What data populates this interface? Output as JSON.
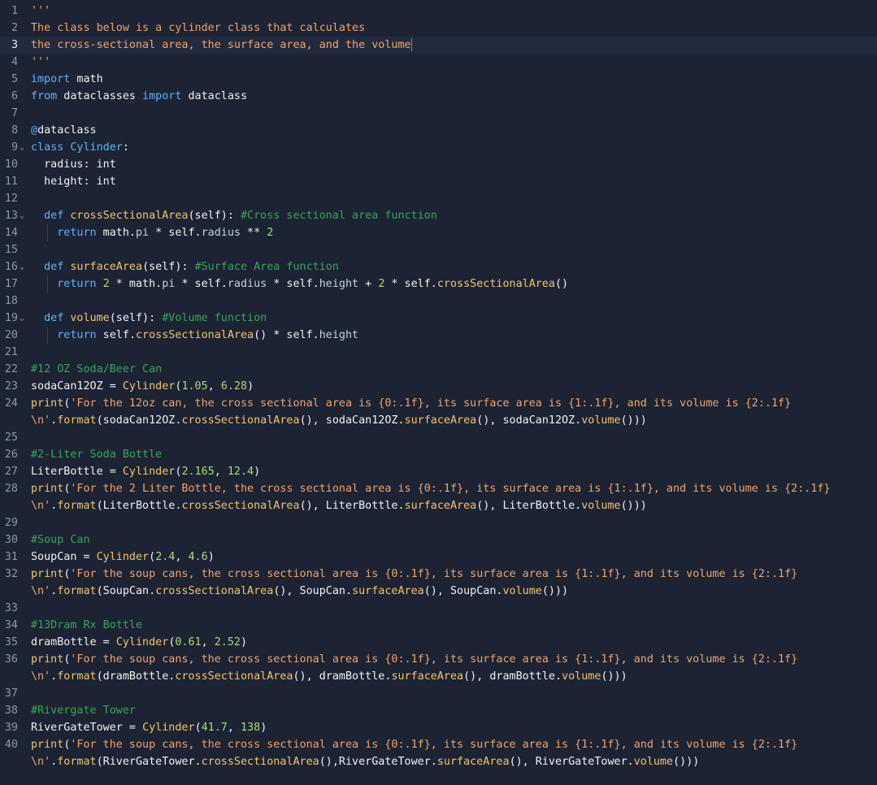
{
  "editor": {
    "lines": [
      {
        "n": "1",
        "tokens": [
          {
            "t": "'''",
            "c": "str"
          }
        ]
      },
      {
        "n": "2",
        "tokens": [
          {
            "t": "The class below is a cylinder class that calculates",
            "c": "str"
          }
        ]
      },
      {
        "n": "3",
        "current": true,
        "tokens": [
          {
            "t": "the cross-sectional area, the surface area, and the volume",
            "c": "str"
          }
        ]
      },
      {
        "n": "4",
        "tokens": [
          {
            "t": "'''",
            "c": "str"
          }
        ]
      },
      {
        "n": "5",
        "tokens": [
          {
            "t": "import",
            "c": "kw"
          },
          {
            "t": " math",
            "c": "plain"
          }
        ]
      },
      {
        "n": "6",
        "tokens": [
          {
            "t": "from",
            "c": "kw"
          },
          {
            "t": " dataclasses ",
            "c": "plain"
          },
          {
            "t": "import",
            "c": "kw"
          },
          {
            "t": " dataclass",
            "c": "plain"
          }
        ]
      },
      {
        "n": "7",
        "tokens": []
      },
      {
        "n": "8",
        "tokens": [
          {
            "t": "@",
            "c": "kw"
          },
          {
            "t": "dataclass",
            "c": "plain"
          }
        ]
      },
      {
        "n": "9",
        "fold": true,
        "tokens": [
          {
            "t": "class",
            "c": "kw"
          },
          {
            "t": " Cylinder",
            "c": "cls"
          },
          {
            "t": ":",
            "c": "plain"
          }
        ]
      },
      {
        "n": "10",
        "tokens": [
          {
            "t": "  radius: int",
            "c": "plain"
          }
        ]
      },
      {
        "n": "11",
        "tokens": [
          {
            "t": "  height: int",
            "c": "plain"
          }
        ]
      },
      {
        "n": "12",
        "tokens": []
      },
      {
        "n": "13",
        "fold": true,
        "tokens": [
          {
            "t": "  ",
            "c": "plain"
          },
          {
            "t": "def",
            "c": "kw"
          },
          {
            "t": " crossSectionalArea",
            "c": "fn"
          },
          {
            "t": "(self): ",
            "c": "plain"
          },
          {
            "t": "#Cross sectional area function",
            "c": "com"
          }
        ]
      },
      {
        "n": "14",
        "tokens": [
          {
            "t": "    ",
            "c": "plain"
          },
          {
            "t": "return",
            "c": "kw"
          },
          {
            "t": " math.",
            "c": "plain"
          },
          {
            "t": "pi",
            "c": "attr"
          },
          {
            "t": " * self.",
            "c": "plain"
          },
          {
            "t": "radius",
            "c": "attr"
          },
          {
            "t": " ** ",
            "c": "plain"
          },
          {
            "t": "2",
            "c": "num"
          }
        ]
      },
      {
        "n": "15",
        "tokens": []
      },
      {
        "n": "16",
        "fold": true,
        "tokens": [
          {
            "t": "  ",
            "c": "plain"
          },
          {
            "t": "def",
            "c": "kw"
          },
          {
            "t": " surfaceArea",
            "c": "fn"
          },
          {
            "t": "(self): ",
            "c": "plain"
          },
          {
            "t": "#Surface Area function",
            "c": "com"
          }
        ]
      },
      {
        "n": "17",
        "tokens": [
          {
            "t": "    ",
            "c": "plain"
          },
          {
            "t": "return",
            "c": "kw"
          },
          {
            "t": " ",
            "c": "plain"
          },
          {
            "t": "2",
            "c": "num"
          },
          {
            "t": " * math.",
            "c": "plain"
          },
          {
            "t": "pi",
            "c": "attr"
          },
          {
            "t": " * self.",
            "c": "plain"
          },
          {
            "t": "radius",
            "c": "attr"
          },
          {
            "t": " * self.",
            "c": "plain"
          },
          {
            "t": "height",
            "c": "attr"
          },
          {
            "t": " + ",
            "c": "plain"
          },
          {
            "t": "2",
            "c": "num"
          },
          {
            "t": " * self.",
            "c": "plain"
          },
          {
            "t": "crossSectionalArea",
            "c": "fn"
          },
          {
            "t": "()",
            "c": "plain"
          }
        ]
      },
      {
        "n": "18",
        "tokens": []
      },
      {
        "n": "19",
        "fold": true,
        "tokens": [
          {
            "t": "  ",
            "c": "plain"
          },
          {
            "t": "def",
            "c": "kw"
          },
          {
            "t": " volume",
            "c": "fn"
          },
          {
            "t": "(self): ",
            "c": "plain"
          },
          {
            "t": "#Volume function",
            "c": "com"
          }
        ]
      },
      {
        "n": "20",
        "tokens": [
          {
            "t": "    ",
            "c": "plain"
          },
          {
            "t": "return",
            "c": "kw"
          },
          {
            "t": " self.",
            "c": "plain"
          },
          {
            "t": "crossSectionalArea",
            "c": "fn"
          },
          {
            "t": "() * self.",
            "c": "plain"
          },
          {
            "t": "height",
            "c": "attr"
          }
        ]
      },
      {
        "n": "21",
        "tokens": []
      },
      {
        "n": "22",
        "tokens": [
          {
            "t": "#12 OZ Soda/Beer Can",
            "c": "com"
          }
        ]
      },
      {
        "n": "23",
        "tokens": [
          {
            "t": "sodaCan12OZ = ",
            "c": "plain"
          },
          {
            "t": "Cylinder",
            "c": "fn"
          },
          {
            "t": "(",
            "c": "plain"
          },
          {
            "t": "1.05",
            "c": "num"
          },
          {
            "t": ", ",
            "c": "plain"
          },
          {
            "t": "6.28",
            "c": "num"
          },
          {
            "t": ")",
            "c": "plain"
          }
        ]
      },
      {
        "n": "24",
        "tokens": [
          {
            "t": "print",
            "c": "fn"
          },
          {
            "t": "(",
            "c": "plain"
          },
          {
            "t": "'For the 12oz can, the cross sectional area is {0:.1f}, its surface area is {1:.1f}, and its volume is {2:.1f}",
            "c": "str"
          }
        ]
      },
      {
        "n": "",
        "tokens": [
          {
            "t": "\\n'",
            "c": "str"
          },
          {
            "t": ".",
            "c": "plain"
          },
          {
            "t": "format",
            "c": "fn"
          },
          {
            "t": "(sodaCan12OZ.",
            "c": "plain"
          },
          {
            "t": "crossSectionalArea",
            "c": "fn"
          },
          {
            "t": "(), sodaCan12OZ.",
            "c": "plain"
          },
          {
            "t": "surfaceArea",
            "c": "fn"
          },
          {
            "t": "(), sodaCan12OZ.",
            "c": "plain"
          },
          {
            "t": "volume",
            "c": "fn"
          },
          {
            "t": "()))",
            "c": "plain"
          }
        ]
      },
      {
        "n": "25",
        "tokens": []
      },
      {
        "n": "26",
        "tokens": [
          {
            "t": "#2-Liter Soda Bottle",
            "c": "com"
          }
        ]
      },
      {
        "n": "27",
        "tokens": [
          {
            "t": "LiterBottle = ",
            "c": "plain"
          },
          {
            "t": "Cylinder",
            "c": "fn"
          },
          {
            "t": "(",
            "c": "plain"
          },
          {
            "t": "2.165",
            "c": "num"
          },
          {
            "t": ", ",
            "c": "plain"
          },
          {
            "t": "12.4",
            "c": "num"
          },
          {
            "t": ")",
            "c": "plain"
          }
        ]
      },
      {
        "n": "28",
        "tokens": [
          {
            "t": "print",
            "c": "fn"
          },
          {
            "t": "(",
            "c": "plain"
          },
          {
            "t": "'For the 2 Liter Bottle, the cross sectional area is {0:.1f}, its surface area is {1:.1f}, and its volume is {2:.1f}",
            "c": "str"
          }
        ]
      },
      {
        "n": "",
        "tokens": [
          {
            "t": "\\n'",
            "c": "str"
          },
          {
            "t": ".",
            "c": "plain"
          },
          {
            "t": "format",
            "c": "fn"
          },
          {
            "t": "(LiterBottle.",
            "c": "plain"
          },
          {
            "t": "crossSectionalArea",
            "c": "fn"
          },
          {
            "t": "(), LiterBottle.",
            "c": "plain"
          },
          {
            "t": "surfaceArea",
            "c": "fn"
          },
          {
            "t": "(), LiterBottle.",
            "c": "plain"
          },
          {
            "t": "volume",
            "c": "fn"
          },
          {
            "t": "()))",
            "c": "plain"
          }
        ]
      },
      {
        "n": "29",
        "tokens": []
      },
      {
        "n": "30",
        "tokens": [
          {
            "t": "#Soup Can",
            "c": "com"
          }
        ]
      },
      {
        "n": "31",
        "tokens": [
          {
            "t": "SoupCan = ",
            "c": "plain"
          },
          {
            "t": "Cylinder",
            "c": "fn"
          },
          {
            "t": "(",
            "c": "plain"
          },
          {
            "t": "2.4",
            "c": "num"
          },
          {
            "t": ", ",
            "c": "plain"
          },
          {
            "t": "4.6",
            "c": "num"
          },
          {
            "t": ")",
            "c": "plain"
          }
        ]
      },
      {
        "n": "32",
        "tokens": [
          {
            "t": "print",
            "c": "fn"
          },
          {
            "t": "(",
            "c": "plain"
          },
          {
            "t": "'For the soup cans, the cross sectional area is {0:.1f}, its surface area is {1:.1f}, and its volume is {2:.1f}",
            "c": "str"
          }
        ]
      },
      {
        "n": "",
        "tokens": [
          {
            "t": "\\n'",
            "c": "str"
          },
          {
            "t": ".",
            "c": "plain"
          },
          {
            "t": "format",
            "c": "fn"
          },
          {
            "t": "(SoupCan.",
            "c": "plain"
          },
          {
            "t": "crossSectionalArea",
            "c": "fn"
          },
          {
            "t": "(), SoupCan.",
            "c": "plain"
          },
          {
            "t": "surfaceArea",
            "c": "fn"
          },
          {
            "t": "(), SoupCan.",
            "c": "plain"
          },
          {
            "t": "volume",
            "c": "fn"
          },
          {
            "t": "()))",
            "c": "plain"
          }
        ]
      },
      {
        "n": "33",
        "tokens": []
      },
      {
        "n": "34",
        "tokens": [
          {
            "t": "#13Dram Rx Bottle",
            "c": "com"
          }
        ]
      },
      {
        "n": "35",
        "tokens": [
          {
            "t": "dramBottle = ",
            "c": "plain"
          },
          {
            "t": "Cylinder",
            "c": "fn"
          },
          {
            "t": "(",
            "c": "plain"
          },
          {
            "t": "0.61",
            "c": "num"
          },
          {
            "t": ", ",
            "c": "plain"
          },
          {
            "t": "2.52",
            "c": "num"
          },
          {
            "t": ")",
            "c": "plain"
          }
        ]
      },
      {
        "n": "36",
        "tokens": [
          {
            "t": "print",
            "c": "fn"
          },
          {
            "t": "(",
            "c": "plain"
          },
          {
            "t": "'For the soup cans, the cross sectional area is {0:.1f}, its surface area is {1:.1f}, and its volume is {2:.1f}",
            "c": "str"
          }
        ]
      },
      {
        "n": "",
        "tokens": [
          {
            "t": "\\n'",
            "c": "str"
          },
          {
            "t": ".",
            "c": "plain"
          },
          {
            "t": "format",
            "c": "fn"
          },
          {
            "t": "(dramBottle.",
            "c": "plain"
          },
          {
            "t": "crossSectionalArea",
            "c": "fn"
          },
          {
            "t": "(), dramBottle.",
            "c": "plain"
          },
          {
            "t": "surfaceArea",
            "c": "fn"
          },
          {
            "t": "(), dramBottle.",
            "c": "plain"
          },
          {
            "t": "volume",
            "c": "fn"
          },
          {
            "t": "()))",
            "c": "plain"
          }
        ]
      },
      {
        "n": "37",
        "tokens": []
      },
      {
        "n": "38",
        "tokens": [
          {
            "t": "#Rivergate Tower",
            "c": "com"
          }
        ]
      },
      {
        "n": "39",
        "tokens": [
          {
            "t": "RiverGateTower = ",
            "c": "plain"
          },
          {
            "t": "Cylinder",
            "c": "fn"
          },
          {
            "t": "(",
            "c": "plain"
          },
          {
            "t": "41.7",
            "c": "num"
          },
          {
            "t": ", ",
            "c": "plain"
          },
          {
            "t": "138",
            "c": "num"
          },
          {
            "t": ")",
            "c": "plain"
          }
        ]
      },
      {
        "n": "40",
        "tokens": [
          {
            "t": "print",
            "c": "fn"
          },
          {
            "t": "(",
            "c": "plain"
          },
          {
            "t": "'For the soup cans, the cross sectional area is {0:.1f}, its surface area is {1:.1f}, and its volume is {2:.1f}",
            "c": "str"
          }
        ]
      },
      {
        "n": "",
        "tokens": [
          {
            "t": "\\n'",
            "c": "str"
          },
          {
            "t": ".",
            "c": "plain"
          },
          {
            "t": "format",
            "c": "fn"
          },
          {
            "t": "(RiverGateTower.",
            "c": "plain"
          },
          {
            "t": "crossSectionalArea",
            "c": "fn"
          },
          {
            "t": "(),RiverGateTower.",
            "c": "plain"
          },
          {
            "t": "surfaceArea",
            "c": "fn"
          },
          {
            "t": "(), RiverGateTower.",
            "c": "plain"
          },
          {
            "t": "volume",
            "c": "fn"
          },
          {
            "t": "()))",
            "c": "plain"
          }
        ]
      }
    ]
  },
  "colors": {
    "background": "#1c2333",
    "string": "#f2a466",
    "keyword": "#5ab4ff",
    "comment": "#34a853",
    "function": "#f3c56b",
    "number": "#a9dc76"
  },
  "icons": {
    "fold": "chevron-down-icon"
  }
}
